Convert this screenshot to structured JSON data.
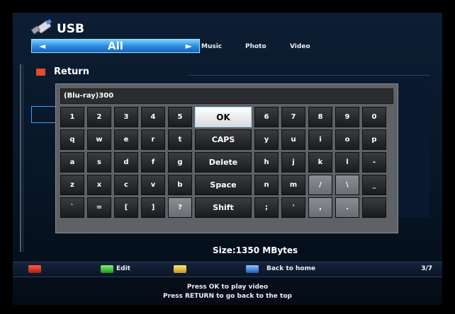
{
  "header": {
    "title": "USB",
    "icon": "usb-icon",
    "category": {
      "left_arrow": "◄",
      "label": "All",
      "right_arrow": "►"
    },
    "tabs": [
      "Music",
      "Photo",
      "Video"
    ]
  },
  "list": {
    "return_label": "Return",
    "return_icon": "return-icon"
  },
  "keyboard": {
    "input_value": "(Blu-ray)300",
    "rows": [
      [
        "1",
        "2",
        "3",
        "4",
        "5",
        "OK",
        "6",
        "7",
        "8",
        "9",
        "0"
      ],
      [
        "q",
        "w",
        "e",
        "r",
        "t",
        "CAPS",
        "y",
        "u",
        "i",
        "o",
        "p"
      ],
      [
        "a",
        "s",
        "d",
        "f",
        "g",
        "Delete",
        "h",
        "j",
        "k",
        "l",
        "-"
      ],
      [
        "z",
        "x",
        "c",
        "v",
        "b",
        "Space",
        "n",
        "m",
        "/",
        "\\",
        "_"
      ],
      [
        "`",
        "=",
        "[",
        "]",
        "?",
        "Shift",
        ";",
        "'",
        ",",
        ".",
        " "
      ]
    ],
    "focused_key": "OK"
  },
  "info": {
    "size": "Size:1350 MBytes"
  },
  "footer": {
    "edit_label": "Edit",
    "back_label": "Back to home",
    "page": "3/7",
    "hint1": "Press OK to play video",
    "hint2": "Press RETURN to go back to the top"
  },
  "colors": {
    "accent": "#2c8fe0",
    "red_key": "#d8281a",
    "green_key": "#2fbf2a",
    "yellow_key": "#e0b820",
    "blue_key": "#3b84e6"
  }
}
